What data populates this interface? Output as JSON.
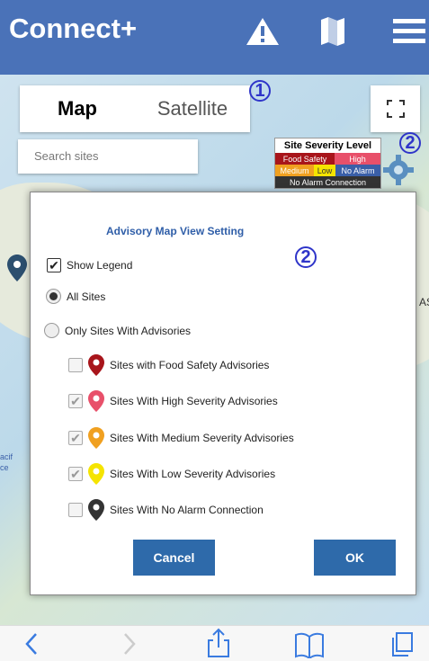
{
  "header": {
    "brand": "Connect+",
    "icons": [
      "warning-icon",
      "map-icon",
      "menu-icon"
    ]
  },
  "map": {
    "tab_map": "Map",
    "tab_satellite": "Satellite",
    "search_placeholder": "Search sites",
    "callout_1": "1",
    "callout_2": "2",
    "side_text_right": "AS",
    "side_text_left_1": "acif",
    "side_text_left_2": "ce"
  },
  "legend": {
    "title": "Site Severity Level",
    "food_safety": "Food Safety",
    "high": "High",
    "medium": "Medium",
    "low": "Low",
    "no_alarm": "No Alarm",
    "no_alarm_connection": "No Alarm Connection",
    "colors": {
      "food_safety": "#a8151b",
      "high": "#e8506a",
      "medium": "#f0a020",
      "low": "#f5e400",
      "no_alarm": "#3a5fa8",
      "no_conn": "#333333"
    }
  },
  "dialog": {
    "title": "Advisory Map View Setting",
    "callout": "2",
    "show_legend": "Show Legend",
    "all_sites": "All Sites",
    "only_advisories": "Only Sites With Advisories",
    "food_safety": "Sites with Food Safety Advisories",
    "high": "Sites With High Severity Advisories",
    "medium": "Sites With Medium Severity Advisories",
    "low": "Sites With Low Severity Advisories",
    "no_alarm": "Sites With No Alarm Connection",
    "cancel": "Cancel",
    "ok": "OK"
  },
  "colors": {
    "header": "#4a72b8",
    "button": "#2e6aaa",
    "callout": "#2f35c9"
  }
}
